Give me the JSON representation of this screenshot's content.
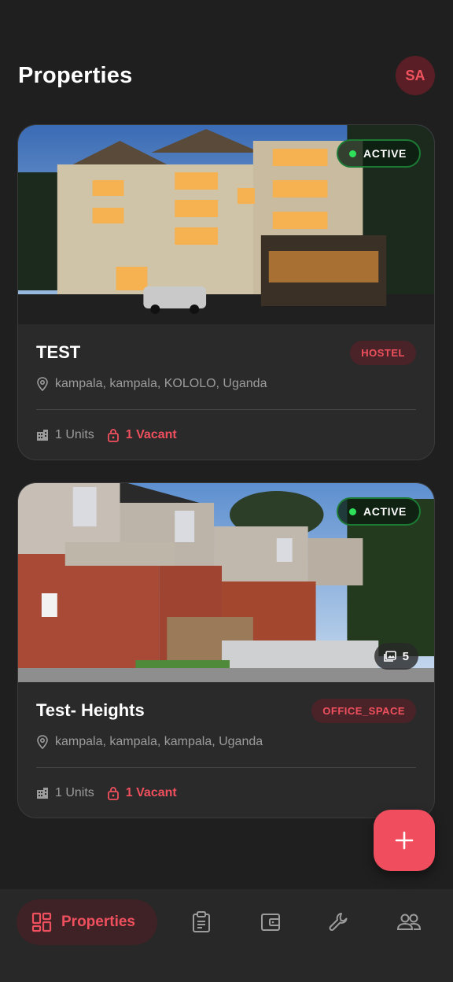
{
  "header": {
    "title": "Properties",
    "avatar_initials": "SA"
  },
  "properties": [
    {
      "name": "TEST",
      "type": "HOSTEL",
      "status": "ACTIVE",
      "address": "kampala, kampala, KOLOLO, Uganda",
      "units": "1 Units",
      "vacant": "1 Vacant"
    },
    {
      "name": "Test- Heights",
      "type": "OFFICE_SPACE",
      "status": "ACTIVE",
      "address": "kampala, kampala, kampala, Uganda",
      "units": "1 Units",
      "vacant": "1 Vacant",
      "photo_count": "5"
    }
  ],
  "nav": {
    "active_label": "Properties",
    "items": [
      "properties-icon",
      "clipboard-icon",
      "wallet-icon",
      "wrench-icon",
      "people-icon"
    ]
  },
  "colors": {
    "background": "#1f1f1f",
    "card": "#2a2a2a",
    "accent": "#f0505e",
    "active_green": "#2ee05a"
  }
}
